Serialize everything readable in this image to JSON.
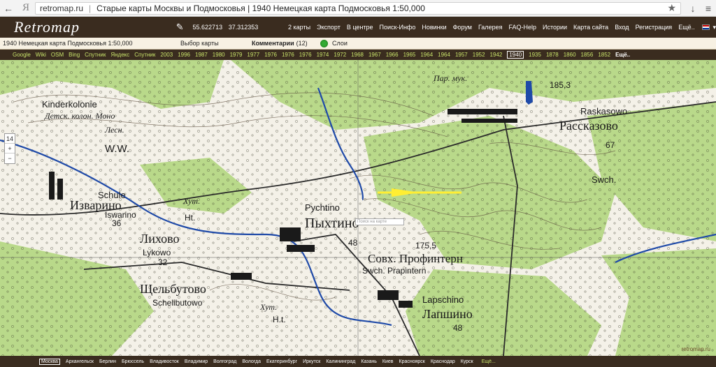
{
  "browser": {
    "host": "retromap.ru",
    "title": "Старые карты Москвы и Подмосковья | 1940 Немецкая карта Подмосковья 1:50,000"
  },
  "header": {
    "logo": "Retromap",
    "lat": "55.622713",
    "lon": "37.312353",
    "nav": [
      "2 карты",
      "Экспорт",
      "В центре",
      "Поиск-Инфо",
      "Новинки",
      "Форум",
      "Галерея",
      "FAQ-Help",
      "Истории",
      "Карта сайта",
      "Вход",
      "Регистрация",
      "Ещё.."
    ]
  },
  "titlebar": {
    "map_title": "1940 Немецкая карта Подмосковья 1:50,000",
    "choose_map": "Выбор карты",
    "comments_label": "Комментарии",
    "comments_count": "(12)",
    "layers": "Слои"
  },
  "layers": {
    "items": [
      "Google",
      "Wiki",
      "OSM",
      "Bing",
      "Спутник",
      "Яндекс",
      "Спутник",
      "2003",
      "1996",
      "1987",
      "1980",
      "1979",
      "1977",
      "1976",
      "1976",
      "1976",
      "1974",
      "1972",
      "1968",
      "1967",
      "1966",
      "1965",
      "1964",
      "1964",
      "1957",
      "1952",
      "1942",
      "1940",
      "1935",
      "1878",
      "1860",
      "1856",
      "1852",
      "Ещё.."
    ],
    "active_index": 27
  },
  "map": {
    "zoom": "14",
    "zoom_in": "+",
    "zoom_out": "−",
    "search_placeholder": "Поиск на карте",
    "watermark": "retromap.ru",
    "labels": {
      "kinderkolonie": "Kinderkolonie",
      "detsk_kolon": "Детск. колон. Моно",
      "lesn": "Лесн.",
      "ww": "W.W.",
      "schule": "Schule",
      "izvarino": "Изварино",
      "iswarino": "Iswarino",
      "n36": "36",
      "hut": "Хут.",
      "ht": "Ht.",
      "pychtino": "Pychtino",
      "pykhtino": "Пыхтино",
      "n48a": "48",
      "likovo": "Лихово",
      "lykowo": "Lykowo",
      "n32": "32",
      "schelbutovo": "Щельбутово",
      "schelbutowo": "Schelibutowo",
      "hut2": "Хут.",
      "ht2": "H.t.",
      "raskasowo": "Raskasowo",
      "rasskazovo": "Рассказово",
      "n67": "67",
      "swch": "Swch.",
      "n185": "185,3",
      "parmuk": "Пар. мук.",
      "sovkh": "Совх. Профинтерн",
      "swchprof": "Swch. Prapintern",
      "n1755": "175,5",
      "lapschino": "Lapschino",
      "lapshino": "Лапшино",
      "n48b": "48"
    }
  },
  "cities": {
    "items": [
      "Москва",
      "Архангельск",
      "Берлин",
      "Брюссель",
      "Владивосток",
      "Владимир",
      "Волгоград",
      "Вологда",
      "Екатеринбург",
      "Иркутск",
      "Калининград",
      "Казань",
      "Киев",
      "Красноярск",
      "Краснодар",
      "Курск"
    ],
    "active_index": 0,
    "note": "Ещё..."
  },
  "colors": {
    "forest": "#b9d98a",
    "clearing": "#f4f1e8",
    "water": "#1f4aa8",
    "road": "#2a2a2a",
    "arrow": "#ffee33"
  }
}
